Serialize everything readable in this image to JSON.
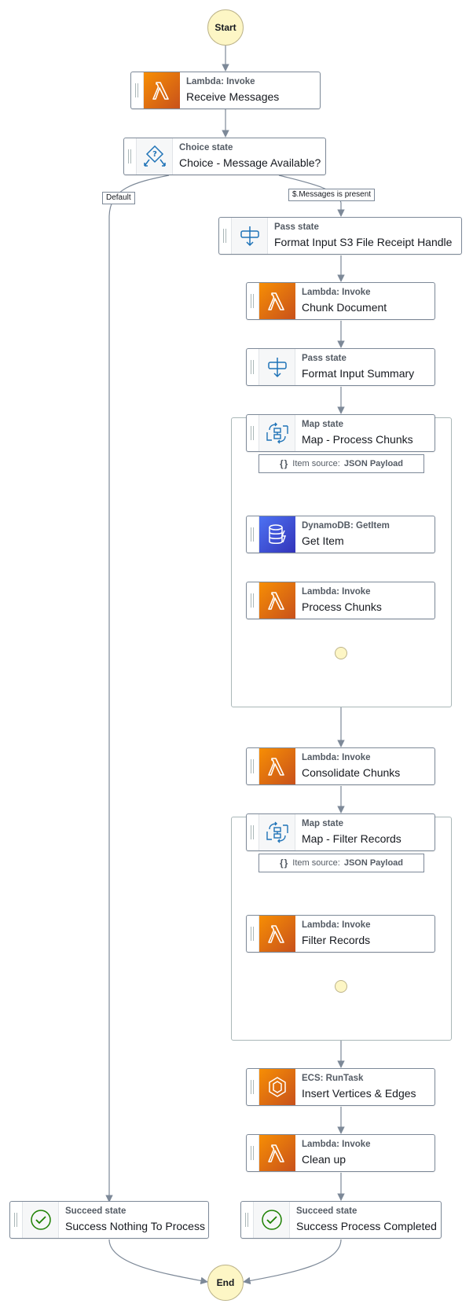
{
  "start_label": "Start",
  "end_label": "End",
  "edge_labels": {
    "default": "Default",
    "messages_present": "$.Messages is present"
  },
  "nodes": {
    "receive_messages": {
      "type": "Lambda: Invoke",
      "name": "Receive Messages"
    },
    "choice": {
      "type": "Choice state",
      "name": "Choice - Message Available?"
    },
    "format_s3": {
      "type": "Pass state",
      "name": "Format Input S3 File Receipt Handle"
    },
    "chunk_document": {
      "type": "Lambda: Invoke",
      "name": "Chunk Document"
    },
    "format_summary": {
      "type": "Pass state",
      "name": "Format Input Summary"
    },
    "map_process": {
      "type": "Map state",
      "name": "Map - Process Chunks"
    },
    "get_item": {
      "type": "DynamoDB: GetItem",
      "name": "Get Item"
    },
    "process_chunks": {
      "type": "Lambda: Invoke",
      "name": "Process Chunks"
    },
    "consolidate": {
      "type": "Lambda: Invoke",
      "name": "Consolidate Chunks"
    },
    "map_filter": {
      "type": "Map state",
      "name": "Map - Filter Records"
    },
    "filter_records": {
      "type": "Lambda: Invoke",
      "name": "Filter Records"
    },
    "insert_vertices": {
      "type": "ECS: RunTask",
      "name": "Insert Vertices & Edges"
    },
    "clean_up": {
      "type": "Lambda: Invoke",
      "name": "Clean up"
    },
    "success_nothing": {
      "type": "Succeed state",
      "name": "Success Nothing To Process"
    },
    "success_completed": {
      "type": "Succeed state",
      "name": "Success Process Completed"
    }
  },
  "item_source": {
    "prefix": "Item source:",
    "value": "JSON Payload"
  },
  "icons": {
    "lambda": "lambda-icon",
    "choice": "choice-icon",
    "pass": "pass-icon",
    "map": "map-icon",
    "dynamodb": "dynamodb-icon",
    "ecs": "ecs-icon",
    "succeed": "check-circle-icon"
  },
  "colors": {
    "lambda_start": "#f78e04",
    "lambda_end": "#c8511b",
    "dynamodb_start": "#4d72f3",
    "dynamodb_end": "#3334b9",
    "terminal_fill": "#fdf6c5",
    "edge": "#7d8998",
    "succeed": "#1d8102"
  }
}
